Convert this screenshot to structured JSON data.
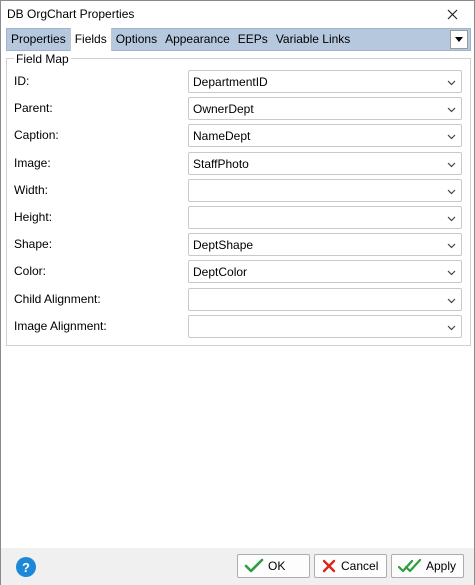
{
  "window": {
    "title": "DB OrgChart Properties"
  },
  "tabs": [
    {
      "label": "Properties",
      "active": false
    },
    {
      "label": "Fields",
      "active": true
    },
    {
      "label": "Options",
      "active": false
    },
    {
      "label": "Appearance",
      "active": false
    },
    {
      "label": "EEPs",
      "active": false
    },
    {
      "label": "Variable Links",
      "active": false
    }
  ],
  "field_map": {
    "legend": "Field Map",
    "rows": [
      {
        "label": "ID:",
        "value": "DepartmentID"
      },
      {
        "label": "Parent:",
        "value": "OwnerDept"
      },
      {
        "label": "Caption:",
        "value": "NameDept"
      },
      {
        "label": "Image:",
        "value": "StaffPhoto"
      },
      {
        "label": "Width:",
        "value": ""
      },
      {
        "label": "Height:",
        "value": ""
      },
      {
        "label": "Shape:",
        "value": "DeptShape"
      },
      {
        "label": "Color:",
        "value": "DeptColor"
      },
      {
        "label": "Child Alignment:",
        "value": ""
      },
      {
        "label": "Image Alignment:",
        "value": ""
      }
    ]
  },
  "buttons": {
    "ok": "OK",
    "cancel": "Cancel",
    "apply": "Apply",
    "help": "?"
  },
  "colors": {
    "tabbar": "#b5c8de",
    "check_green": "#2e9e3e",
    "cancel_red": "#d9271c",
    "help_blue": "#1e88d8"
  }
}
